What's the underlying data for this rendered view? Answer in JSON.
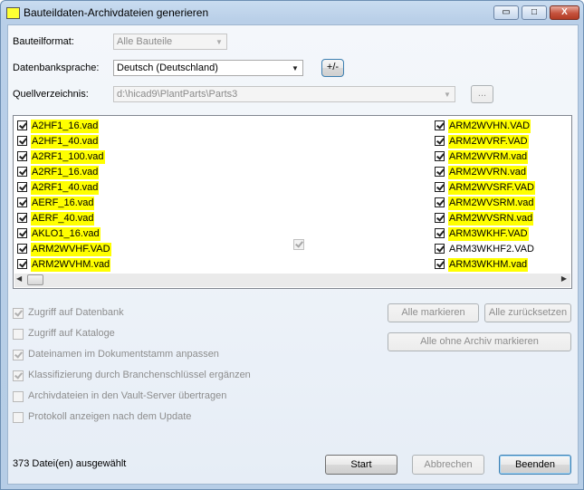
{
  "window": {
    "title": "Bauteildaten-Archivdateien generieren",
    "minimize_glyph": "▭",
    "maximize_glyph": "□",
    "close_glyph": "X"
  },
  "form": {
    "bauteilformat_label": "Bauteilformat:",
    "bauteilformat_value": "Alle Bauteile",
    "sprache_label": "Datenbanksprache:",
    "sprache_value": "Deutsch (Deutschland)",
    "plusminus_label": "+/-",
    "quelle_label": "Quellverzeichnis:",
    "quelle_value": "d:\\hicad9\\PlantParts\\Parts3",
    "browse_label": "..."
  },
  "file_list": {
    "left": [
      {
        "name": "A2HF1_16.vad",
        "highlighted": true
      },
      {
        "name": "A2HF1_40.vad",
        "highlighted": true
      },
      {
        "name": "A2RF1_100.vad",
        "highlighted": true
      },
      {
        "name": "A2RF1_16.vad",
        "highlighted": true
      },
      {
        "name": "A2RF1_40.vad",
        "highlighted": true
      },
      {
        "name": "AERF_16.vad",
        "highlighted": true
      },
      {
        "name": "AERF_40.vad",
        "highlighted": true
      },
      {
        "name": "AKLO1_16.vad",
        "highlighted": true
      },
      {
        "name": "ARM2WVHF.VAD",
        "highlighted": true
      },
      {
        "name": "ARM2WVHM.vad",
        "highlighted": true
      }
    ],
    "right": [
      {
        "name": "ARM2WVHN.VAD",
        "highlighted": true
      },
      {
        "name": "ARM2WVRF.VAD",
        "highlighted": true
      },
      {
        "name": "ARM2WVRM.vad",
        "highlighted": true
      },
      {
        "name": "ARM2WVRN.vad",
        "highlighted": true
      },
      {
        "name": "ARM2WVSRF.VAD",
        "highlighted": true
      },
      {
        "name": "ARM2WVSRM.vad",
        "highlighted": true
      },
      {
        "name": "ARM2WVSRN.vad",
        "highlighted": true
      },
      {
        "name": "ARM3WKHF.VAD",
        "highlighted": true
      },
      {
        "name": "ARM3WKHF2.VAD",
        "highlighted": false
      },
      {
        "name": "ARM3WKHM.vad",
        "highlighted": true
      }
    ],
    "scroll_left_glyph": "◀",
    "scroll_right_glyph": "▶"
  },
  "options": [
    {
      "label": "Zugriff auf Datenbank",
      "checked": true
    },
    {
      "label": "Zugriff auf Kataloge",
      "checked": false
    },
    {
      "label": "Dateinamen im Dokumentstamm anpassen",
      "checked": true
    },
    {
      "label": "Klassifizierung durch Branchenschlüssel ergänzen",
      "checked": true
    },
    {
      "label": "Archivdateien in den Vault-Server übertragen",
      "checked": false
    },
    {
      "label": "Protokoll anzeigen nach dem Update",
      "checked": false
    }
  ],
  "buttons": {
    "alle_markieren": "Alle markieren",
    "alle_zuruecksetzen": "Alle zurücksetzen",
    "alle_ohne_archiv": "Alle ohne Archiv markieren",
    "start": "Start",
    "abbrechen": "Abbrechen",
    "beenden": "Beenden"
  },
  "status_text": "373 Datei(en) ausgewählt",
  "colors": {
    "highlight": "#ffff00"
  }
}
